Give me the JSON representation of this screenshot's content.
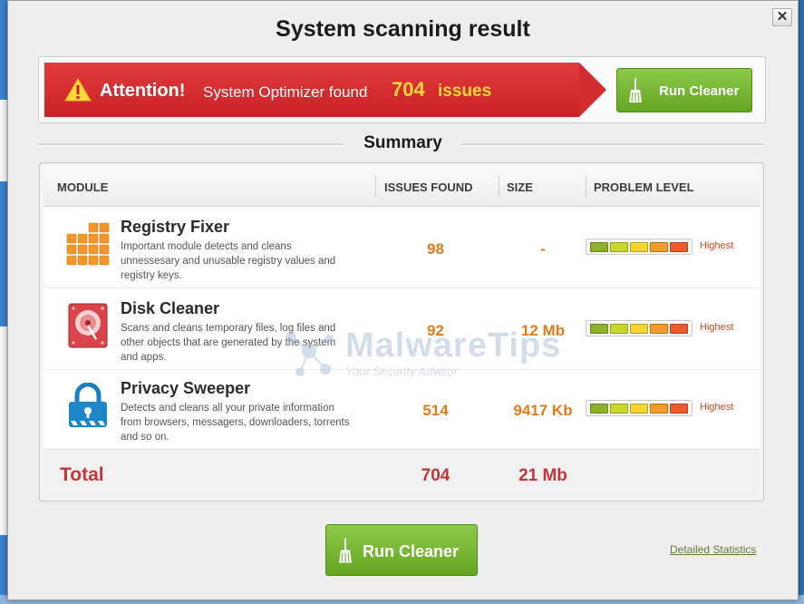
{
  "dialog": {
    "title": "System scanning result",
    "close_glyph": "✕"
  },
  "alert": {
    "label": "Attention!",
    "text": "System Optimizer found",
    "count": "704",
    "unit": "issues",
    "button_label": "Run Cleaner",
    "icon": "warning-triangle-icon"
  },
  "summary": {
    "title": "Summary",
    "columns": [
      "MODULE",
      "ISSUES FOUND",
      "SIZE",
      "PROBLEM LEVEL"
    ],
    "rows": [
      {
        "name": "Registry Fixer",
        "description": "Important module detects and cleans unnessesary and unusable registry values and registry keys.",
        "issues": "98",
        "size": "-",
        "level": "Highest",
        "icon": "registry-grid-icon"
      },
      {
        "name": "Disk Cleaner",
        "description": "Scans and cleans temporary files, log files and other objects that are generated by the system and apps.",
        "issues": "92",
        "size": "12 Mb",
        "level": "Highest",
        "icon": "hard-disk-icon"
      },
      {
        "name": "Privacy Sweeper",
        "description": "Detects and cleans all your private information from browsers, messagers, downloaders, torrents and so on.",
        "issues": "514",
        "size": "9417 Kb",
        "level": "Highest",
        "icon": "padlock-icon"
      }
    ],
    "total": {
      "label": "Total",
      "issues": "704",
      "size": "21 Mb"
    },
    "level_colors": [
      "#8db227",
      "#c8d62b",
      "#f2d52e",
      "#f29a2c",
      "#ee5a2b"
    ]
  },
  "watermark": {
    "title": "MalwareTips",
    "subtitle": "Your Security Advisor"
  },
  "footer": {
    "run_cleaner_label": "Run Cleaner",
    "stats_link": "Detailed Statistics"
  },
  "colors": {
    "alert_red": "#d42c2f",
    "accent_orange": "#e07b1c",
    "total_red": "#c2353b",
    "button_green": "#76b633"
  }
}
